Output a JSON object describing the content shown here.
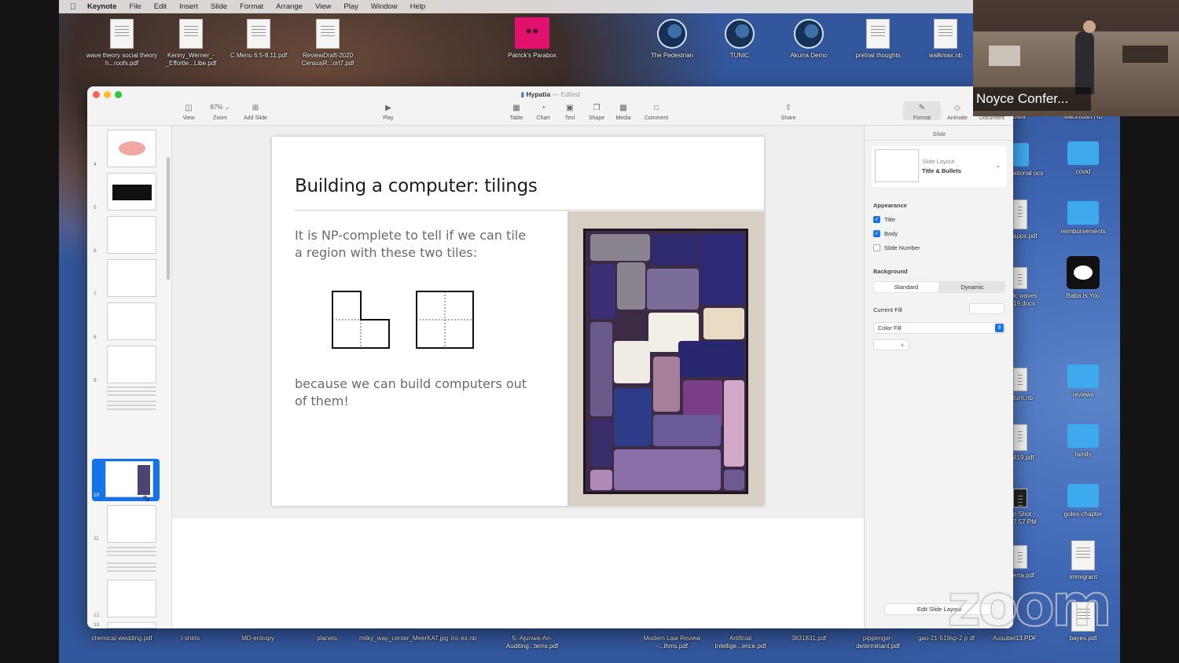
{
  "menubar": {
    "app": "Keynote",
    "items": [
      "File",
      "Edit",
      "Insert",
      "Slide",
      "Format",
      "Arrange",
      "View",
      "Play",
      "Window",
      "Help"
    ],
    "zoom_label": "zoom"
  },
  "desktop_top": [
    {
      "label": "wave theory social theory h...roofs.pdf"
    },
    {
      "label": "Kenny_Werner_-_Effortle...Libe.pdf"
    },
    {
      "label": "C Menu 6.5-8.11.pdf"
    },
    {
      "label": "ReviewDraft-2020 CensusR...ort7.pdf"
    },
    {
      "label": "Patrick's Parabox"
    },
    {
      "label": "The Pedestrian"
    },
    {
      "label": "TUNIC"
    },
    {
      "label": "Akurra Demo"
    },
    {
      "label": "pretrial thoughts"
    },
    {
      "label": "walkmax.nb"
    }
  ],
  "desktop_right": [
    {
      "label": "data"
    },
    {
      "label": "Macintosh HD"
    },
    {
      "label": "ational ocs"
    },
    {
      "label": "covid"
    },
    {
      "label": "apps.pdf"
    },
    {
      "label": "reimbursements"
    },
    {
      "label": "ic waves 19.docx"
    },
    {
      "label": "Baba Is You"
    },
    {
      "label": "turn.nb"
    },
    {
      "label": "reviews"
    },
    {
      "label": "419.pdf"
    },
    {
      "label": "family"
    },
    {
      "label": "n Shot 7.57 PM"
    },
    {
      "label": "goles-chapter"
    },
    {
      "label": "erta.pdf"
    },
    {
      "label": "immigrant"
    },
    {
      "label": "bayes.pdf"
    }
  ],
  "desktop_bottom": [
    {
      "label": "chemical-wedding.pdf"
    },
    {
      "label": "t-shirts"
    },
    {
      "label": "MD-entropy"
    },
    {
      "label": "planets"
    },
    {
      "label": "milky_way_center_MeerKAT.jpg"
    },
    {
      "label": "inc-ex.nb"
    },
    {
      "label": "5.-Ajunwa-An-Auditing...tems.pdf"
    },
    {
      "label": "Modern Law Review -...thms.pdf"
    },
    {
      "label": "Artificial Intellige...ence.pdf"
    },
    {
      "label": "3831831.pdf"
    },
    {
      "label": "pippenger-determinant.pdf"
    },
    {
      "label": "gao-21-519sp-2.p df"
    },
    {
      "label": "Ausubel13.PDF"
    }
  ],
  "window": {
    "title": "Hypatia",
    "title_suffix": "— Edited",
    "toolbar": {
      "view": "View",
      "zoom_value": "87%",
      "zoom": "Zoom",
      "add_slide": "Add Slide",
      "play": "Play",
      "table": "Table",
      "chart": "Chart",
      "text": "Text",
      "shape": "Shape",
      "media": "Media",
      "comment": "Comment",
      "share": "Share",
      "format": "Format",
      "animate": "Animate",
      "document": "Document"
    }
  },
  "navigator": {
    "slide_numbers": [
      "4",
      "5",
      "6",
      "7",
      "8",
      "9",
      "10",
      "11",
      "12",
      "13"
    ],
    "selected": "10"
  },
  "slide": {
    "title": "Building a computer: tilings",
    "body1": "It is NP-complete to tell if we can tile a region with these two tiles:",
    "body2": "because we can build computers out of them!"
  },
  "inspector": {
    "tab": "Slide",
    "layout_label": "Slide Layout",
    "layout_value": "Title & Bullets",
    "appearance": "Appearance",
    "title_cb": "Title",
    "body_cb": "Body",
    "slide_number_cb": "Slide Number",
    "background": "Background",
    "standard": "Standard",
    "dynamic": "Dynamic",
    "current_fill": "Current Fill",
    "color_fill": "Color Fill",
    "edit_layout": "Edit Slide Layout"
  },
  "video": {
    "name": "Noyce Confer..."
  },
  "zoom_watermark": "zoom"
}
